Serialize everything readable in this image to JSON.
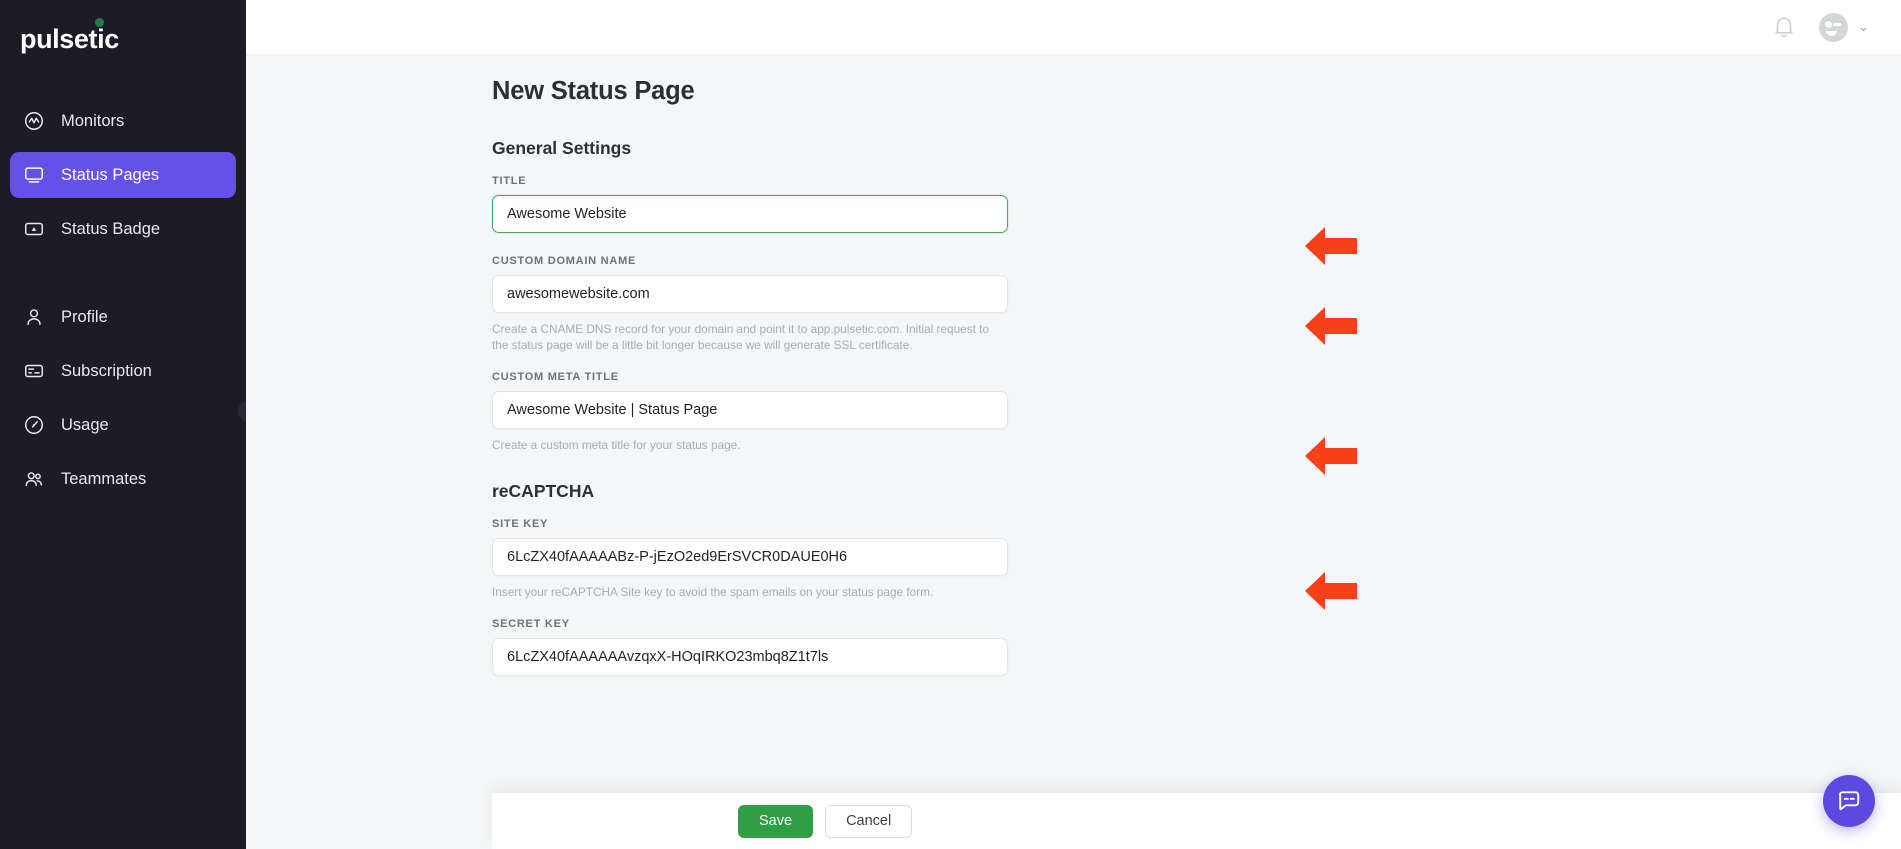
{
  "brand": {
    "name": "pulsetic"
  },
  "sidebar": {
    "items": [
      {
        "label": "Monitors",
        "icon": "monitor-pulse-icon",
        "active": false
      },
      {
        "label": "Status Pages",
        "icon": "status-page-icon",
        "active": true
      },
      {
        "label": "Status Badge",
        "icon": "status-badge-icon",
        "active": false
      },
      {
        "label": "Profile",
        "icon": "person-icon",
        "active": false
      },
      {
        "label": "Subscription",
        "icon": "credit-card-icon",
        "active": false
      },
      {
        "label": "Usage",
        "icon": "gauge-icon",
        "active": false
      },
      {
        "label": "Teammates",
        "icon": "people-icon",
        "active": false
      }
    ],
    "collapse_glyph": "‹"
  },
  "topbar": {
    "notifications_icon": "bell-icon",
    "avatar_icon": "user-avatar",
    "dropdown_glyph": "⌄"
  },
  "page": {
    "title": "New Status Page",
    "sections": {
      "general": {
        "heading": "General Settings"
      },
      "recaptcha": {
        "heading": "reCAPTCHA"
      }
    },
    "fields": {
      "title": {
        "label": "TITLE",
        "value": "Awesome Website",
        "focused": true
      },
      "custom_domain": {
        "label": "CUSTOM DOMAIN NAME",
        "value": "awesomewebsite.com",
        "help": "Create a CNAME DNS record for your domain and point it to app.pulsetic.com. Initial request to the status page will be a little bit longer because we will generate SSL certificate."
      },
      "custom_meta_title": {
        "label": "CUSTOM META TITLE",
        "value": "Awesome Website | Status Page",
        "help": "Create a custom meta title for your status page."
      },
      "site_key": {
        "label": "SITE KEY",
        "value": "6LcZX40fAAAAABz-P-jEzO2ed9ErSVCR0DAUE0H6",
        "help": "Insert your reCAPTCHA Site key to avoid the spam emails on your status page form."
      },
      "secret_key": {
        "label": "SECRET KEY",
        "value": "6LcZX40fAAAAAAvzqxX-HOqIRKO23mbq8Z1t7ls"
      }
    }
  },
  "footer": {
    "save_label": "Save",
    "cancel_label": "Cancel"
  },
  "chat": {
    "icon": "chat-bubble-icon"
  },
  "colors": {
    "sidebar_bg": "#1d1b26",
    "accent_purple": "#6351e8",
    "save_green": "#2f9e44",
    "focus_green": "#4aa564",
    "arrow_red": "#f5401a",
    "page_bg": "#f4f7f7"
  }
}
